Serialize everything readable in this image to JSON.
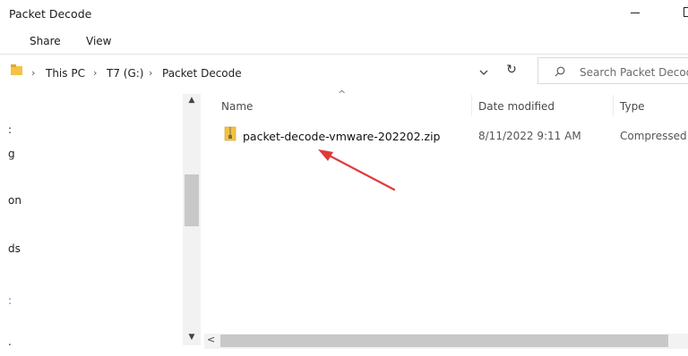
{
  "window": {
    "title": "Packet Decode"
  },
  "ribbon": {
    "tabs": [
      "Share",
      "View"
    ]
  },
  "address_bar": {
    "breadcrumbs": [
      "This PC",
      "T7 (G:)",
      "Packet Decode"
    ],
    "search_placeholder": "Search Packet Decode"
  },
  "nav_pane": {
    "visible_fragments": [
      ":",
      "g",
      "on",
      "ds",
      ":",
      "."
    ]
  },
  "file_list": {
    "columns": [
      "Name",
      "Date modified",
      "Type"
    ],
    "rows": [
      {
        "name": "packet-decode-vmware-202202.zip",
        "date_modified": "8/11/2022 9:11 AM",
        "type": "Compressed"
      }
    ]
  },
  "colors": {
    "annotation_arrow": "#e03a3a",
    "nav_highlight": "#2f7bd8",
    "zip_folder": "#f5c242"
  },
  "icons": [
    "minimize-icon",
    "maximize-icon",
    "folder-icon",
    "chevron-down-icon",
    "refresh-icon",
    "search-icon",
    "zip-folder-icon",
    "red-annotation-arrow"
  ]
}
